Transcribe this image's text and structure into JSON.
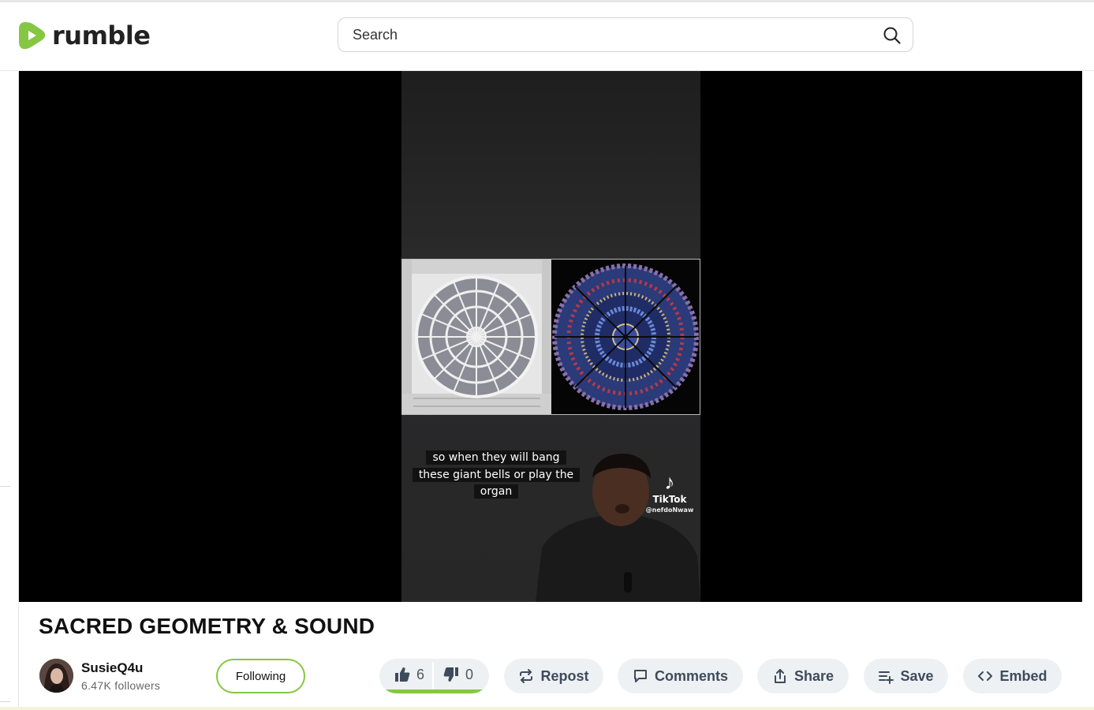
{
  "header": {
    "logo_text": "rumble",
    "search_placeholder": "Search"
  },
  "video": {
    "caption_lines": [
      "so when they will bang",
      "these giant bells or play the",
      "organ"
    ],
    "watermark_app": "TikTok",
    "watermark_handle": "@nefdoNwaw"
  },
  "title": "SACRED GEOMETRY & SOUND",
  "channel": {
    "name": "SusieQ4u",
    "followers": "6.47K followers",
    "follow_label": "Following"
  },
  "votes": {
    "likes": "6",
    "dislikes": "0",
    "like_ratio": 1.0
  },
  "actions": {
    "repost": "Repost",
    "comments": "Comments",
    "share": "Share",
    "save": "Save",
    "embed": "Embed"
  },
  "colors": {
    "brand_green": "#85c742",
    "button_bg": "#eef1f4",
    "button_text": "#3e4b5c"
  }
}
